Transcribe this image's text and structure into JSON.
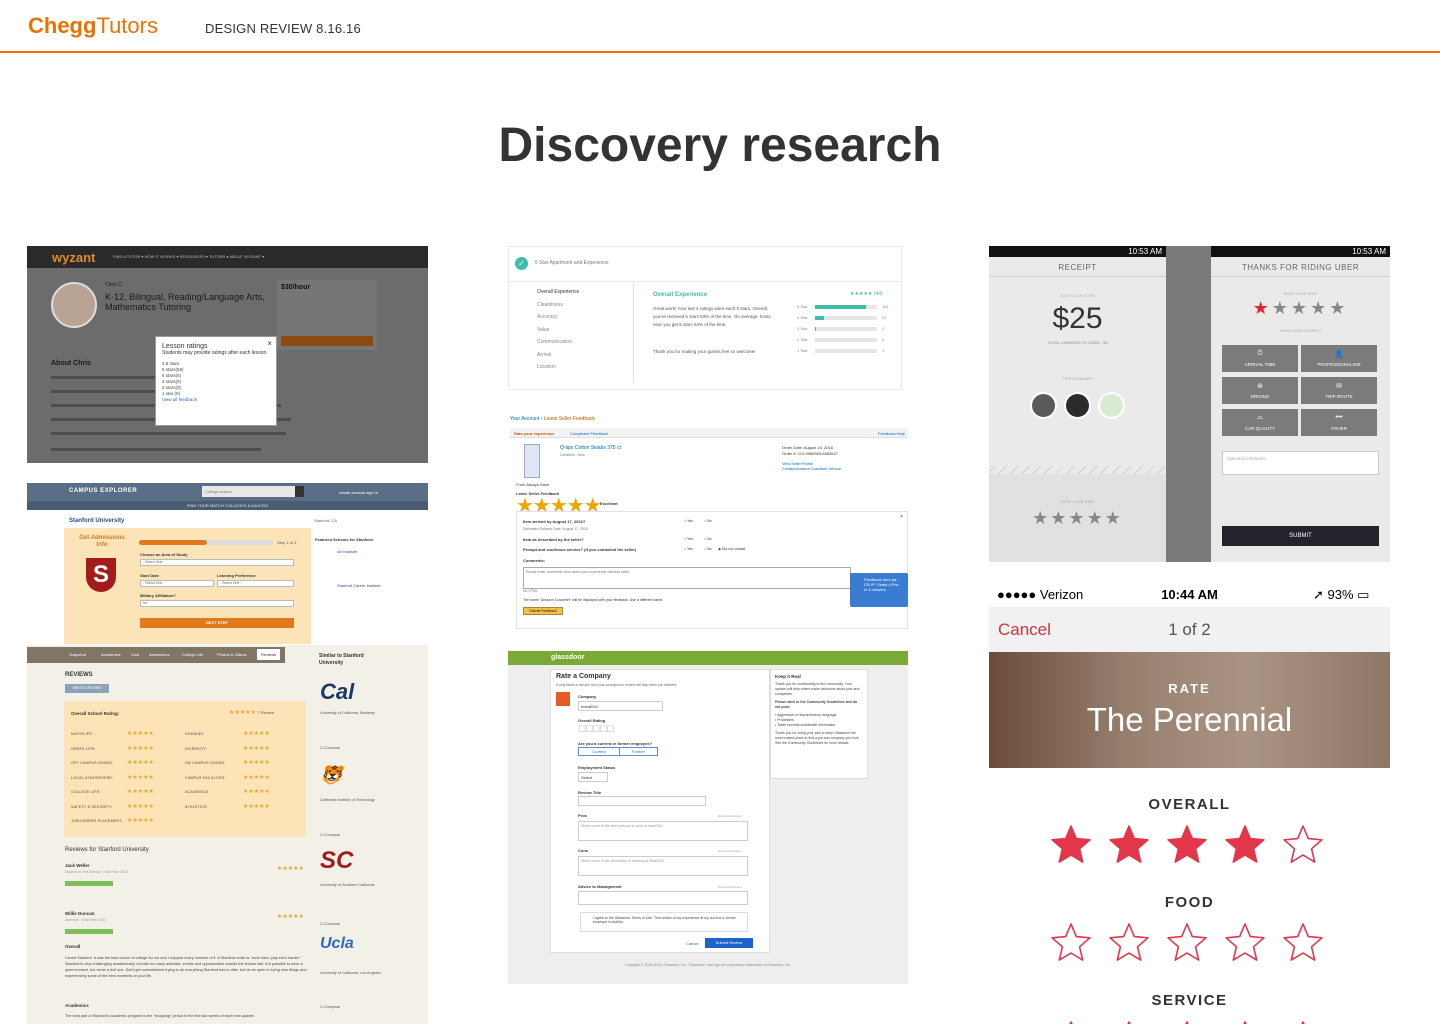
{
  "header": {
    "logo_brand": "Chegg",
    "logo_product": "Tutors",
    "review_title": "DESIGN REVIEW 8.16.16"
  },
  "page_title": "Discovery research",
  "colors": {
    "accent": "#eb7100",
    "star_red": "#e3364a",
    "uber_red": "#e3262e"
  },
  "wyzant": {
    "brand": "wyzant",
    "nav_links": "FIND A TUTOR ▾   HOW IT WORKS ▾   RESOURCES ▾   TUTORS ▾   ABOUT WYZANT ▾",
    "tutor_name": "Chris C.",
    "tutor_title": "K-12, Bilingual, Reading/Language Arts, Mathematics Tutoring",
    "price": "$30/hour",
    "about": "About Chris",
    "modal": {
      "title": "Lesson ratings",
      "subtitle": "Students may provide ratings after each lesson.",
      "rows": [
        "4.5 stars",
        "5 stars(59)",
        "4 stars(6)",
        "3 stars(0)",
        "2 stars(0)",
        "1 star  (0)"
      ],
      "link": "View all feedback",
      "close": "×"
    }
  },
  "campus": {
    "brand": "CAMPUS EXPLORER",
    "search_placeholder": "College search...",
    "account": "create account   sign in",
    "subnav": "FIND YOUR MATCH    COLLEGES & MAJORS",
    "school": "Stanford University",
    "location": "Stanford, CA",
    "get_admissions": "Get Admissions Info",
    "step": "Step 1 of 3",
    "fields": [
      "Choose an Area of Study",
      "Start Date",
      "Learning Preference",
      "Military Affiliation?"
    ],
    "select_default": "- Select One -",
    "next_step": "NEXT STEP",
    "featured_title": "Featured Schools for Stanford:",
    "featured": [
      "Art Institute",
      "Stanford Career Institute"
    ],
    "tabs": [
      "Snapshot",
      "Academics",
      "Cost",
      "Admissions",
      "College Life",
      "Photos & Videos",
      "Reviews"
    ],
    "similar_title": "Similar to Stanford University",
    "reviews_heading": "REVIEWS",
    "write_review": "WRITE A REVIEW",
    "overall_rating": "Overall School Rating:",
    "review_count": "7 Review",
    "categories_left": [
      "NIGHTLIFE:",
      "GREEK LIFE:",
      "OFF CAMPUS DINING:",
      "LOCAL ATMOSPHERE:",
      "COLLEGE LIFE:",
      "SAFETY & SECURITY:",
      "JOB/CAREER PLACEMENT:"
    ],
    "categories_right": [
      "HOUSING:",
      "DIVERSITY:",
      "ON CAMPUS DINING:",
      "CAMPUS FACILITIES:",
      "ACADEMICS:",
      "ATHLETICS:"
    ],
    "reviews_for": "Reviews for Stanford University",
    "reviewers": [
      {
        "name": "Jack Weller",
        "sub": "Student at This School · Grad Year 2015"
      },
      {
        "name": "Willie Duncan",
        "sub": "Alumnus · Grad Year 2001"
      }
    ],
    "overall_heading": "Overall",
    "overall_text": "I loved Stanford. It was the best choice of college for me and I enjoyed every moment of it. A Stanford motto is \"work hard, play even harder.\" Stanford is very challenging academically, but with so many activities, events and opportunities outside the lecture hall, it is possible to have a quiet moment, but never a dull one. Don't get overwhelmed trying to do everything Stanford has to offer, but do be open to trying new things and experiencing some of the best moments of your life.",
    "academics_heading": "Academics",
    "academics_text": "The best part of Stanford's academic program is the \"shopping\" period in the first two weeks of each new quarter.",
    "similar_schools": [
      {
        "logo": "Cal",
        "name": "University of California, Berkeley"
      },
      {
        "logo": "🐯",
        "name": "California Institute of Technology"
      },
      {
        "logo": "SC",
        "name": "University of Southern California"
      },
      {
        "logo": "Ucla",
        "name": "University of California, Los Angeles"
      }
    ],
    "compare": "Compare"
  },
  "airbnb": {
    "title": "5 Star Apartment and Experience",
    "items": [
      "Overall Experience",
      "Cleanliness",
      "Accuracy",
      "Value",
      "Communication",
      "Arrival",
      "Location"
    ],
    "heading": "Overall Experience",
    "body": "Great work! Your last 4 ratings were each 5 stars. Overall, you've received 5 stars 83% of the time. On average, hosts near you get 5 stars 64% of the time.",
    "thanks": "Thank you for making your guests feel so welcome!",
    "stars_label": "★★★★★ (44)",
    "breakdown": [
      {
        "label": "5 Star",
        "value": 0.83,
        "count": "119"
      },
      {
        "label": "4 Star",
        "value": 0.15,
        "count": "22"
      },
      {
        "label": "3 Star",
        "value": 0.02,
        "count": "2"
      },
      {
        "label": "2 Star",
        "value": 0.0,
        "count": "0"
      },
      {
        "label": "1 Star",
        "value": 0.0,
        "count": "1"
      }
    ]
  },
  "amazon": {
    "crumb_account": "Your Account",
    "crumb_current": "Leave Seller Feedback",
    "tab_rate": "Rate your experience",
    "tab_completed": "Completed Feedback",
    "help": "Feedback Help",
    "product": "Q-tips Cotton Swabs 375 ct",
    "condition": "Condition : New",
    "order_date": "Order Date: August 15, 2016",
    "order_num": "Order #: 113-9966369-6582637",
    "seller_links": "View Seller Profile\nContact Amazon Customer Service",
    "from": "From Always Save",
    "leave": "Leave Seller Feedback",
    "stars": "★★★★★",
    "excellent": "Excellent",
    "questions": [
      {
        "q": "Item arrived by August 17, 2016?",
        "sub": "Estimated Delivery Date: August 17, 2016"
      },
      {
        "q": "Item as described by the seller?",
        "sub": ""
      },
      {
        "q": "Prompt and courteous service? (If you contacted the seller)",
        "sub": ""
      }
    ],
    "yes": "Yes",
    "no": "No",
    "did_not_contact": "Did not contact",
    "comments_label": "Comments:",
    "comments_placeholder": "Please enter comments here about your experience with this seller.",
    "no_html": "No HTML",
    "display_note": "The name \"Amazon Customer\" will be displayed with your feedback. Use a different name.",
    "submit": "Submit Feedback",
    "toast": "Feedback form pa... CR-IP: Seats 4-Pro... in 4 minutes"
  },
  "glassdoor": {
    "brand": "glassdoor",
    "heading": "Rate a Company",
    "sub": "It only takes a minute! And your anonymous review will help other job seekers.",
    "company_label": "Company",
    "company_value": "InstaEDU",
    "overall_label": "Overall Rating",
    "employee_q": "Are you a current or former employee?",
    "current": "Current",
    "former": "Former",
    "status_label": "Employment Status",
    "status_value": "Select",
    "review_title": "Review Title",
    "pros": "Pros",
    "pros_ph": "Share some of the best reasons to work at InstaEDU",
    "cons": "Cons",
    "cons_ph": "Share some of the downsides of working at InstaEDU",
    "advice": "Advice to Management",
    "min_words": "20 word minimum",
    "agree": "I agree to the Glassdoor Terms of Use. This review of my experience at my current or former employer is truthful.",
    "cancel": "Cancel",
    "submit": "Submit Review",
    "side_title": "Keep it Real",
    "side_p1": "Thank you for contributing to the community. Your opinion will help others make decisions about jobs and companies.",
    "side_p2": "Please stick to the Community Guidelines and do not post:",
    "side_list": "• Aggressive or discriminatory language\n• Profanities\n• Trade secrets/confidential information",
    "side_p3": "Thank you for doing your part to keep Glassdoor the most trusted place to find a job and company you love. See the Community Guidelines for more details.",
    "footer": "Copyright © 2008-2016, Glassdoor, Inc. \"Glassdoor\" and logo are proprietary trademarks of Glassdoor, Inc."
  },
  "uber": {
    "status_time": "10:53 AM",
    "receipt_title": "RECEIPT",
    "date": "JULY 14, 09:17 PM",
    "amount": "$25",
    "total": "TOTAL CHARGED TO CARD · $3",
    "trip_summary": "TRIP SUMMARY",
    "rate_your_ride": "RATE YOUR RIDE",
    "thanks_title": "THANKS FOR RIDING UBER",
    "what_went_wrong": "WHAT DIDN'T WORK?",
    "options": [
      "ARRIVAL TIME",
      "PROFESSIONALISM",
      "DRIVING",
      "TRIP ROUTE",
      "CAR QUALITY",
      "OTHER"
    ],
    "option_icons": [
      "clock-icon",
      "person-icon",
      "steering-icon",
      "map-icon",
      "car-icon",
      "more-icon"
    ],
    "comments_placeholder": "Optional comments",
    "submit": "SUBMIT",
    "rating": 1
  },
  "ios": {
    "carrier": "●●●●● Verizon",
    "time": "10:44 AM",
    "battery": "93%",
    "cancel": "Cancel",
    "count": "1 of 2",
    "rate": "RATE",
    "restaurant": "The Perennial",
    "categories": [
      {
        "label": "OVERALL",
        "rating": 4
      },
      {
        "label": "FOOD",
        "rating": 0
      },
      {
        "label": "SERVICE",
        "rating": 0
      }
    ]
  }
}
